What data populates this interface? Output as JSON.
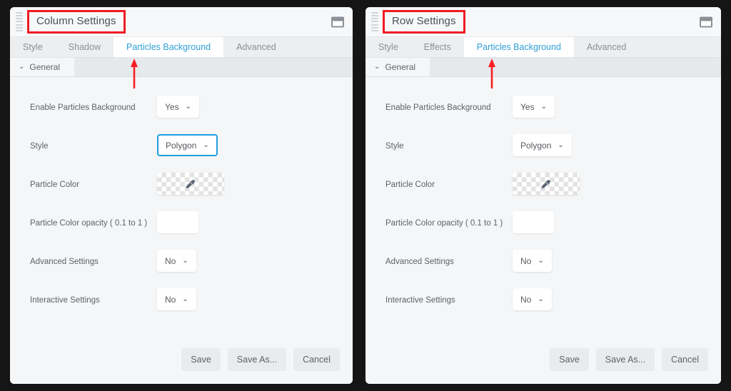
{
  "theme": {
    "background": "#151515",
    "panel_bg": "#f5f6f7",
    "accent_tab": "#2f9fd6",
    "focus_border": "#1e9fe0",
    "annotation_red": "#ee1c25",
    "label_color": "#5c6268"
  },
  "panels": [
    {
      "id": "column-settings",
      "title": "Column Settings",
      "window_button": "maximize-restore-icon",
      "drag_handle": "grip-icon",
      "tabs": [
        {
          "label": "Style",
          "active": false
        },
        {
          "label": "Shadow",
          "active": false
        },
        {
          "label": "Particles Background",
          "active": true
        },
        {
          "label": "Advanced",
          "active": false
        }
      ],
      "section": {
        "label": "General",
        "chevron": "⌄"
      },
      "fields": [
        {
          "label": "Enable Particles Background",
          "type": "select",
          "value": "Yes",
          "focused": false
        },
        {
          "label": "Style",
          "type": "select",
          "value": "Polygon",
          "focused": true
        },
        {
          "label": "Particle Color",
          "type": "color",
          "value": "",
          "focused": false
        },
        {
          "label": "Particle Color opacity ( 0.1 to 1 )",
          "type": "text",
          "value": "",
          "focused": false
        },
        {
          "label": "Advanced Settings",
          "type": "select",
          "value": "No",
          "focused": false
        },
        {
          "label": "Interactive Settings",
          "type": "select",
          "value": "No",
          "focused": false
        }
      ],
      "footer": [
        {
          "label": "Save"
        },
        {
          "label": "Save As..."
        },
        {
          "label": "Cancel"
        }
      ]
    },
    {
      "id": "row-settings",
      "title": "Row Settings",
      "window_button": "maximize-restore-icon",
      "drag_handle": "grip-icon",
      "tabs": [
        {
          "label": "Style",
          "active": false
        },
        {
          "label": "Effects",
          "active": false
        },
        {
          "label": "Particles Background",
          "active": true
        },
        {
          "label": "Advanced",
          "active": false
        }
      ],
      "section": {
        "label": "General",
        "chevron": "⌄"
      },
      "fields": [
        {
          "label": "Enable Particles Background",
          "type": "select",
          "value": "Yes",
          "focused": false
        },
        {
          "label": "Style",
          "type": "select",
          "value": "Polygon",
          "focused": false
        },
        {
          "label": "Particle Color",
          "type": "color",
          "value": "",
          "focused": false
        },
        {
          "label": "Particle Color opacity ( 0.1 to 1 )",
          "type": "text",
          "value": "",
          "focused": false
        },
        {
          "label": "Advanced Settings",
          "type": "select",
          "value": "No",
          "focused": false
        },
        {
          "label": "Interactive Settings",
          "type": "select",
          "value": "No",
          "focused": false
        }
      ],
      "footer": [
        {
          "label": "Save"
        },
        {
          "label": "Save As..."
        },
        {
          "label": "Cancel"
        }
      ]
    }
  ],
  "annotations": {
    "title_boxes": [
      "Column Settings",
      "Row Settings"
    ],
    "arrows": [
      "points-to-particles-background-tab-left",
      "points-to-particles-background-tab-right"
    ]
  },
  "icons": {
    "caret": "⌄",
    "eyedropper": "eyedropper-icon"
  }
}
